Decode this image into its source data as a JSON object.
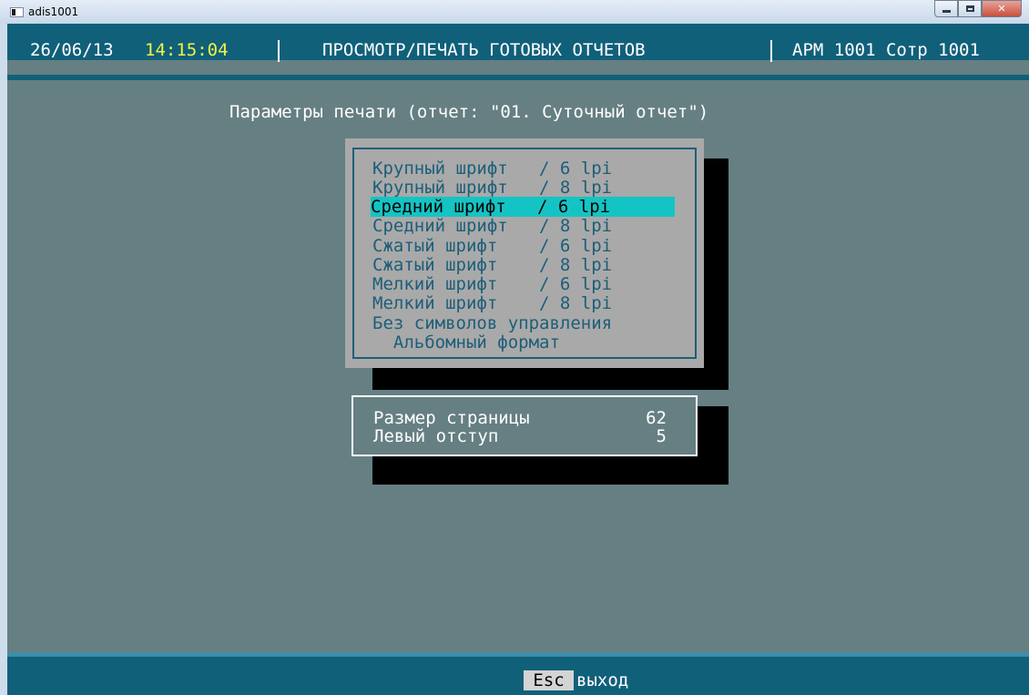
{
  "window": {
    "title": "adis1001",
    "controls": [
      "minimize",
      "maximize",
      "close"
    ]
  },
  "header": {
    "date": "26/06/13",
    "time": "14:15:04",
    "title": "ПРОСМОТР/ПЕЧАТЬ ГОТОВЫХ ОТЧЕТОВ",
    "workstation": "АРМ 1001 Сотр 1001"
  },
  "subtitle": "Параметры печати (отчет: \"01. Суточный отчет\")",
  "font_menu": {
    "selected_index": 2,
    "items": [
      "Крупный шрифт   / 6 lpi",
      "Крупный шрифт   / 8 lpi",
      "Средний шрифт   / 6 lpi",
      "Средний шрифт   / 8 lpi",
      "Сжатый шрифт    / 6 lpi",
      "Сжатый шрифт    / 8 lpi",
      "Мелкий шрифт    / 6 lpi",
      "Мелкий шрифт    / 8 lpi",
      "Без символов управления",
      "  Альбомный формат"
    ]
  },
  "page_params": {
    "page_size_label": "Размер страницы",
    "page_size_value": "62",
    "left_margin_label": "Левый отступ",
    "left_margin_value": "5"
  },
  "footer": {
    "key": "Esc",
    "action": "выход"
  },
  "colors": {
    "background": "#667f83",
    "header_bar": "#11607a",
    "time_color": "#f2f246",
    "menu_panel": "#a9a9a9",
    "menu_text": "#1d5e79",
    "selection": "#14c4c4"
  }
}
